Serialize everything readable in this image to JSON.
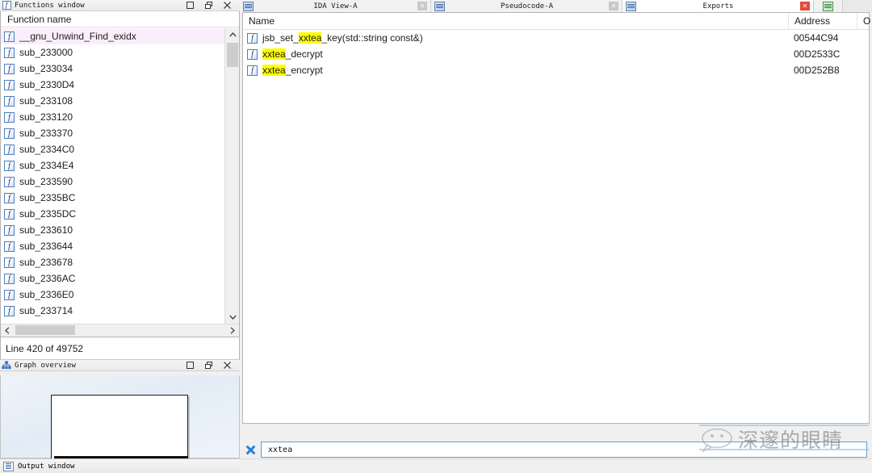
{
  "functions_window": {
    "title": "Functions window",
    "icon": "function-window-icon",
    "buttons": {
      "restore": "❐",
      "maximize": "❐",
      "close": "✕"
    },
    "column_header": "Function name",
    "items": [
      {
        "name": "__gnu_Unwind_Find_exidx",
        "selected": true
      },
      {
        "name": "sub_233000",
        "selected": false
      },
      {
        "name": "sub_233034",
        "selected": false
      },
      {
        "name": "sub_2330D4",
        "selected": false
      },
      {
        "name": "sub_233108",
        "selected": false
      },
      {
        "name": "sub_233120",
        "selected": false
      },
      {
        "name": "sub_233370",
        "selected": false
      },
      {
        "name": "sub_2334C0",
        "selected": false
      },
      {
        "name": "sub_2334E4",
        "selected": false
      },
      {
        "name": "sub_233590",
        "selected": false
      },
      {
        "name": "sub_2335BC",
        "selected": false
      },
      {
        "name": "sub_2335DC",
        "selected": false
      },
      {
        "name": "sub_233610",
        "selected": false
      },
      {
        "name": "sub_233644",
        "selected": false
      },
      {
        "name": "sub_233678",
        "selected": false
      },
      {
        "name": "sub_2336AC",
        "selected": false
      },
      {
        "name": "sub_2336E0",
        "selected": false
      },
      {
        "name": "sub_233714",
        "selected": false
      }
    ],
    "status_line": "Line 420 of 49752"
  },
  "graph_overview": {
    "title": "Graph overview",
    "icon": "graph-overview-icon",
    "buttons": {
      "restore": "❐",
      "maximize": "❐",
      "close": "✕"
    }
  },
  "output_window": {
    "title": "Output window",
    "icon": "output-window-icon"
  },
  "tabs": [
    {
      "label": "IDA View-A",
      "active": false,
      "close": "✕",
      "icon": "ida-view-icon"
    },
    {
      "label": "Pseudocode-A",
      "active": false,
      "close": "✕",
      "icon": "pseudocode-icon"
    },
    {
      "label": "Exports",
      "active": true,
      "close": "✕",
      "icon": "exports-icon"
    },
    {
      "label": "",
      "active": false,
      "close": "",
      "icon": "structures-icon"
    }
  ],
  "exports": {
    "columns": [
      "Name",
      "Address",
      "O"
    ],
    "rows": [
      {
        "name_parts": [
          {
            "text": "jsb_set_",
            "highlight": false
          },
          {
            "text": "xxtea",
            "highlight": true
          },
          {
            "text": "_key(std::string const&)",
            "highlight": false
          }
        ],
        "address": "00544C94",
        "icon": "function-icon"
      },
      {
        "name_parts": [
          {
            "text": "xxtea",
            "highlight": true
          },
          {
            "text": "_decrypt",
            "highlight": false
          }
        ],
        "address": "00D2533C",
        "icon": "function-icon"
      },
      {
        "name_parts": [
          {
            "text": "xxtea",
            "highlight": true
          },
          {
            "text": "_encrypt",
            "highlight": false
          }
        ],
        "address": "00D252B8",
        "icon": "function-icon"
      }
    ]
  },
  "search": {
    "value": "xxtea",
    "placeholder": "",
    "clear_icon": "✖",
    "clear_icon_name": "clear-search-icon"
  },
  "watermark": {
    "text": "深邃的眼睛",
    "icon": "wechat-bubble-icon"
  },
  "colors": {
    "highlight": "#ffff00",
    "selection": "#fbeefb",
    "accent": "#2f7fe0",
    "tab_close_active": "#e04a3a"
  }
}
